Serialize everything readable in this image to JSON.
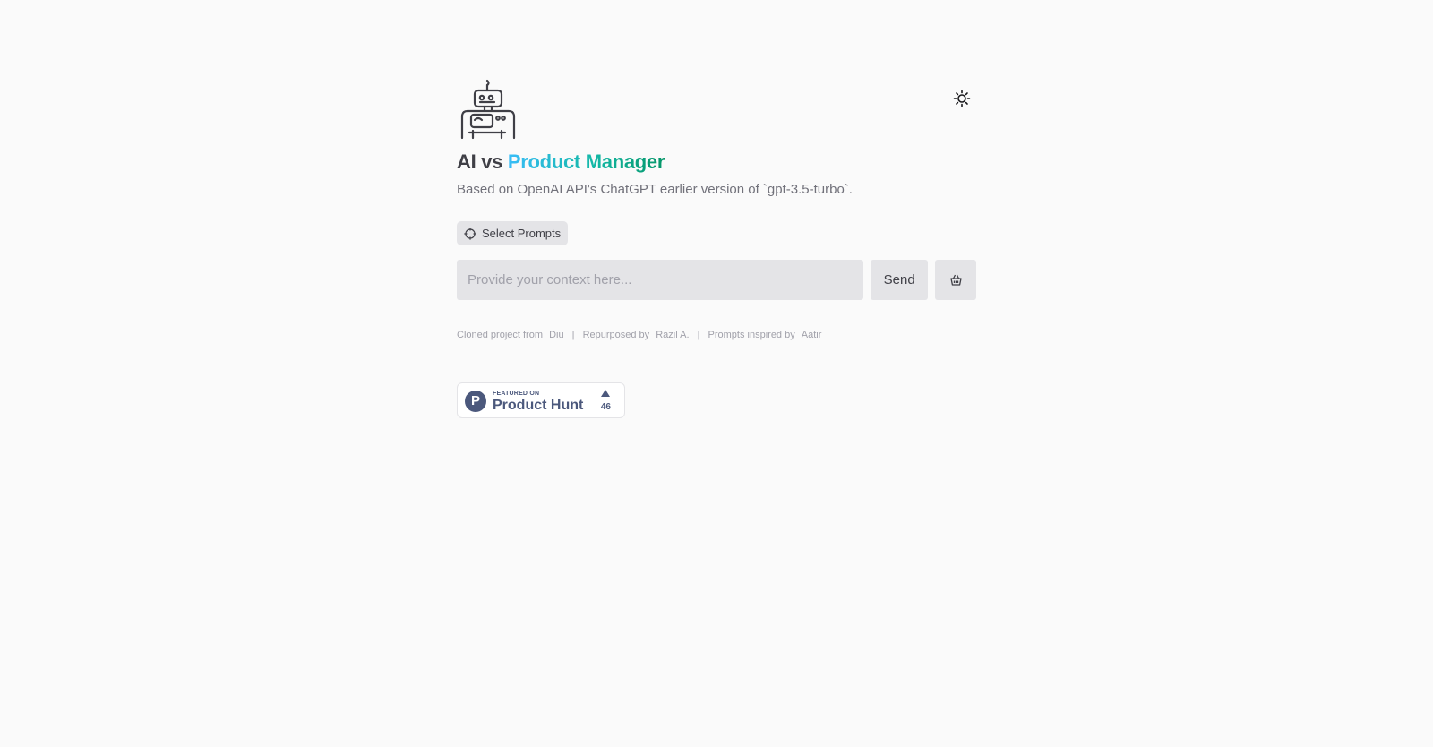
{
  "header": {
    "title_prefix": "AI vs",
    "title_accent": "Product Manager",
    "subtitle": "Based on OpenAI API's ChatGPT earlier version of `gpt-3.5-turbo`.",
    "logo_icon": "robot-icon",
    "theme_icon": "sun-icon"
  },
  "prompts": {
    "select_label": "Select Prompts",
    "icon": "crosshair-icon"
  },
  "input": {
    "placeholder": "Provide your context here...",
    "value": "",
    "send_label": "Send",
    "clear_icon": "basket-icon"
  },
  "footer": {
    "cloned_label": "Cloned project from",
    "cloned_link": "Diu",
    "repurposed_label": "Repurposed by",
    "repurposed_link": "Razil A.",
    "inspired_label": "Prompts inspired by",
    "inspired_link": "Aatir",
    "separator": "|"
  },
  "product_hunt": {
    "featured_on": "FEATURED ON",
    "name": "Product Hunt",
    "logo_letter": "P",
    "upvotes": "46"
  },
  "colors": {
    "background": "#fafafa",
    "accent_start": "#38bdf8",
    "accent_end": "#059669",
    "product_hunt": "#4b587c"
  }
}
